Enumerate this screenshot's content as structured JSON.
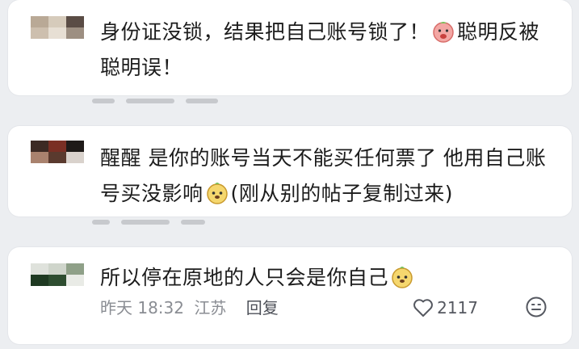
{
  "comments": [
    {
      "text_before_emoji": "身份证没锁，结果把自己账号锁了！",
      "text_after_emoji": "聪明反被聪明误！",
      "emoji_icon": "pink-peach-emoji-icon"
    },
    {
      "text_before_emoji": "醒醒 是你的账号当天不能买任何票了 他用自己账号买没影响",
      "text_after_emoji": "(刚从别的帖子复制过来)",
      "emoji_icon": "yellow-dog-emoji-icon"
    },
    {
      "text_before_emoji": "所以停在原地的人只会是你自己",
      "emoji_icon": "yellow-dog-emoji-icon",
      "meta": {
        "time": "昨天 18:32",
        "location": "江苏",
        "reply_label": "回复",
        "like_count": "2117"
      }
    }
  ],
  "colors": {
    "background": "#eceef1",
    "card": "#ffffff",
    "text": "#1c1c1c",
    "meta": "#8a8d93"
  }
}
